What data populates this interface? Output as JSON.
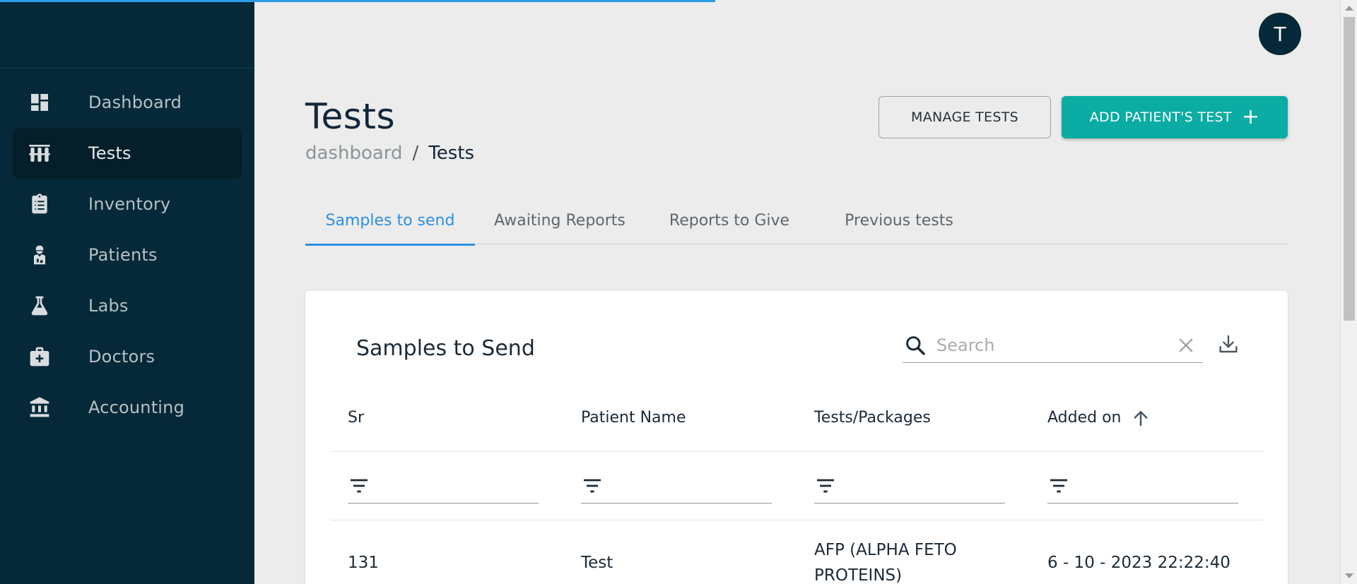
{
  "progress": {
    "fraction": 0.527,
    "color": "#2d9ae6"
  },
  "sidebar": {
    "items": [
      {
        "label": "Dashboard",
        "icon": "dashboard-icon",
        "active": false
      },
      {
        "label": "Tests",
        "icon": "test-tubes-icon",
        "active": true
      },
      {
        "label": "Inventory",
        "icon": "clipboard-list-icon",
        "active": false
      },
      {
        "label": "Patients",
        "icon": "patient-icon",
        "active": false
      },
      {
        "label": "Labs",
        "icon": "flask-icon",
        "active": false
      },
      {
        "label": "Doctors",
        "icon": "medical-kit-icon",
        "active": false
      },
      {
        "label": "Accounting",
        "icon": "bank-icon",
        "active": false
      }
    ]
  },
  "user": {
    "avatar_letter": "T"
  },
  "page": {
    "title": "Tests",
    "breadcrumb": {
      "parent": "dashboard",
      "separator": "/",
      "current": "Tests"
    },
    "manage_button": "MANAGE TESTS",
    "add_button": "ADD PATIENT'S TEST",
    "add_button_icon": "+"
  },
  "tabs": [
    {
      "label": "Samples to send",
      "active": true
    },
    {
      "label": "Awaiting Reports",
      "active": false
    },
    {
      "label": "Reports to Give",
      "active": false
    },
    {
      "label": "Previous tests",
      "active": false
    }
  ],
  "table": {
    "title": "Samples to Send",
    "search_placeholder": "Search",
    "columns": [
      "Sr",
      "Patient Name",
      "Tests/Packages",
      "Added on"
    ],
    "sort_column": "Added on",
    "sort_direction": "ascending",
    "rows": [
      {
        "sr": "131",
        "patient_name": "Test",
        "tests": "AFP (ALPHA FETO PROTEINS)",
        "added_on": "6 - 10 - 2023 22:22:40"
      }
    ]
  },
  "colors": {
    "sidebar_bg": "#052938",
    "primary": "#0aaca3",
    "accent": "#2d8fe0"
  }
}
